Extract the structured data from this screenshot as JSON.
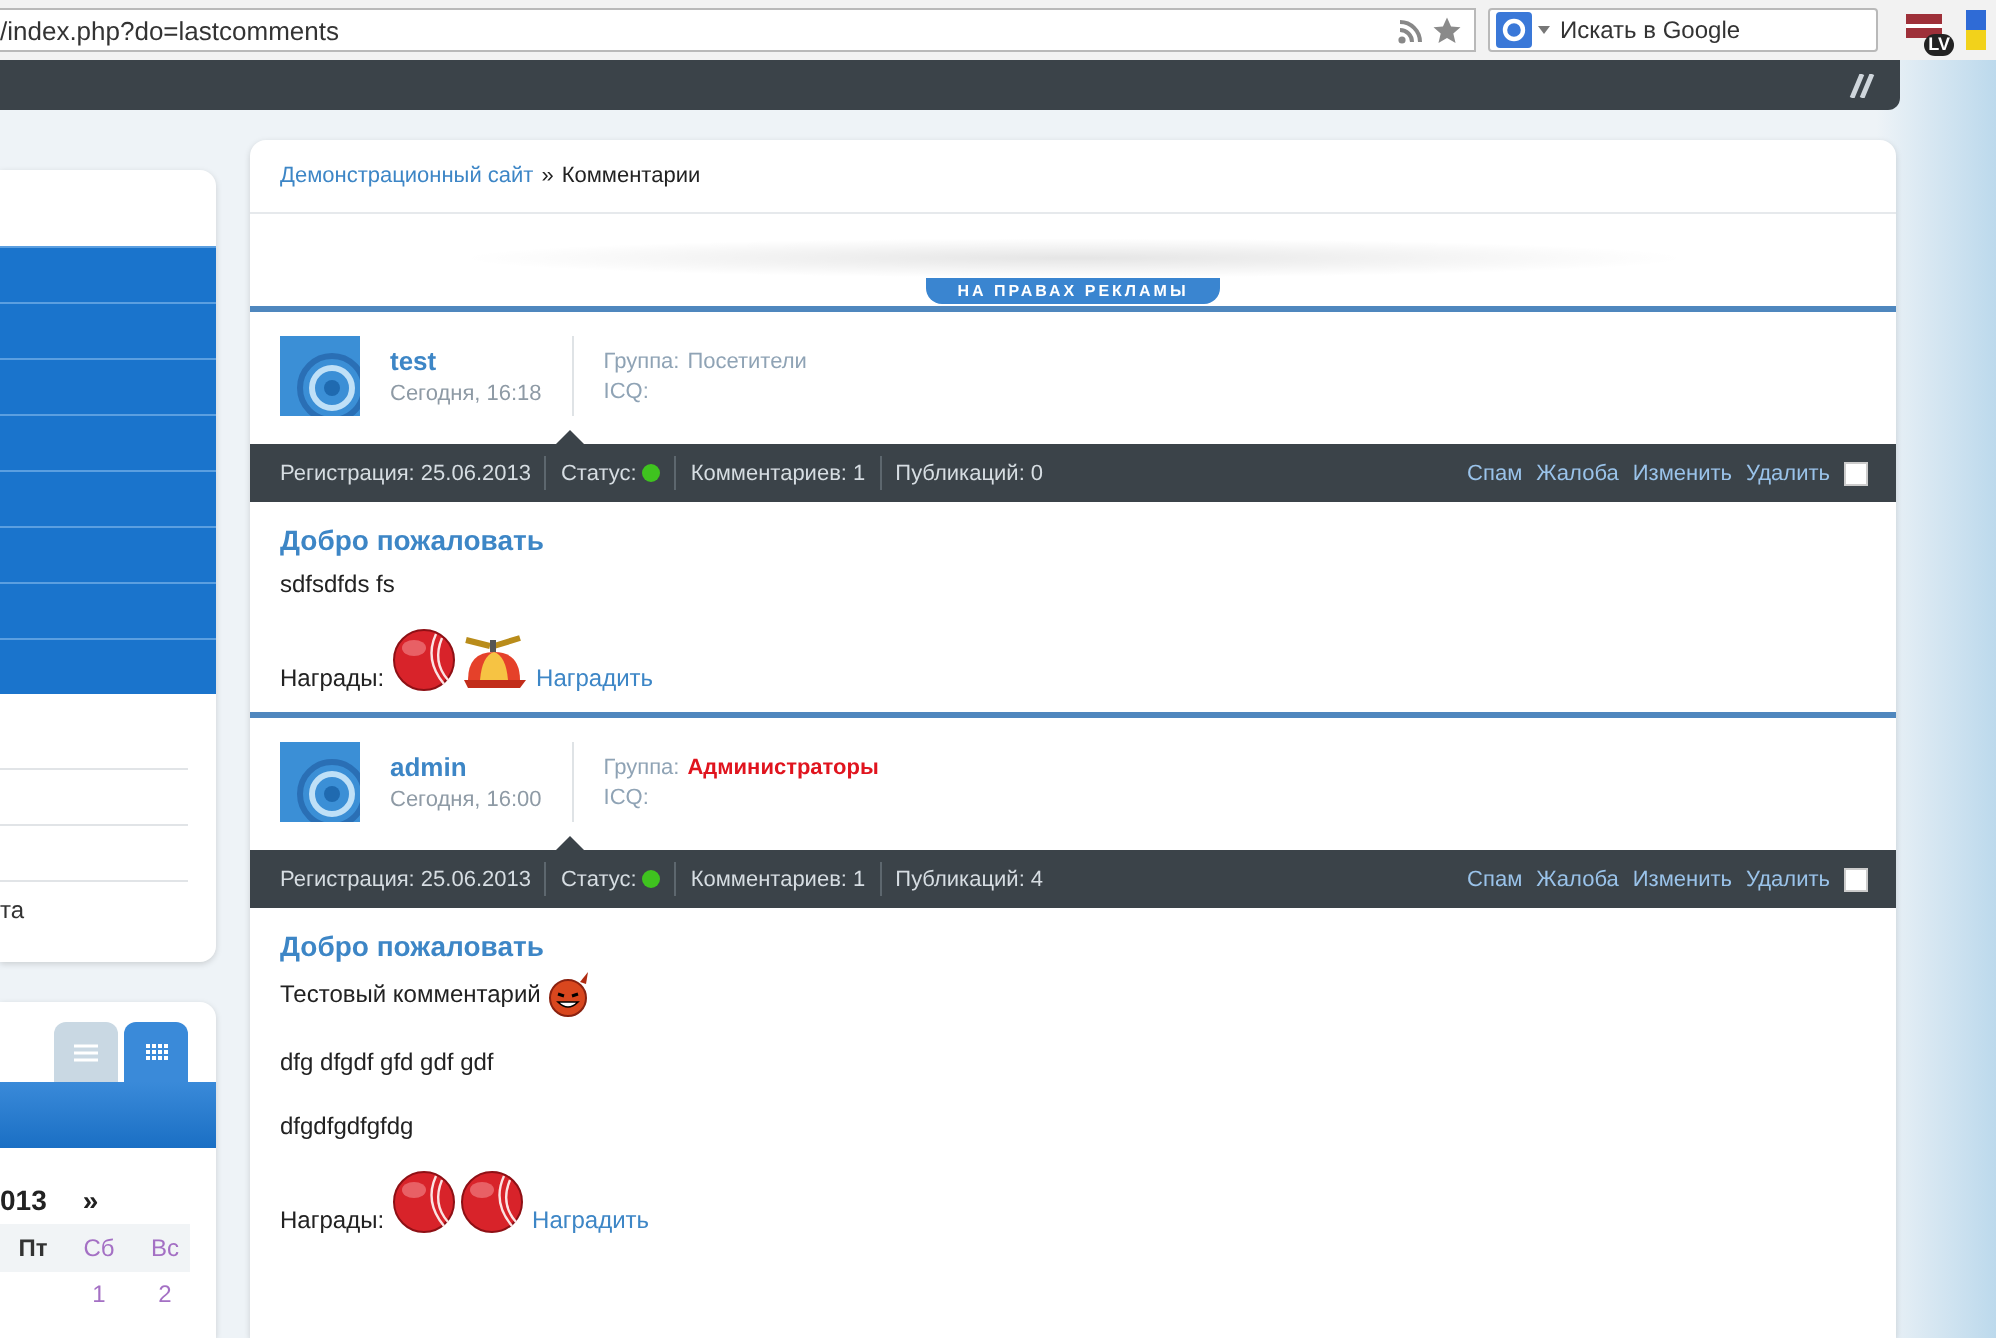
{
  "browser": {
    "url": "/index.php?do=lastcomments",
    "search": {
      "placeholder": "Искать в Google"
    },
    "extensions": [
      {
        "label": "LV"
      }
    ]
  },
  "sidebar": {
    "items": [
      {
        "label": "та"
      }
    ],
    "calendar": {
      "view_tabs": [
        {
          "kind": "list",
          "selected": false
        },
        {
          "kind": "grid",
          "selected": true
        }
      ],
      "year": "013",
      "next": "»",
      "days": [
        {
          "label": "Пт",
          "weekend": false
        },
        {
          "label": "Сб",
          "weekend": true,
          "date": "1"
        },
        {
          "label": "Вс",
          "weekend": true,
          "date": "2"
        }
      ]
    }
  },
  "breadcrumb": {
    "link": "Демонстрационный сайт",
    "separator": "»",
    "current": "Комментарии"
  },
  "ad_badge": "НА ПРАВАХ РЕКЛАМЫ",
  "comments": [
    {
      "author": "test",
      "time": "Сегодня, 16:18",
      "group_label": "Группа:",
      "group": "Посетители",
      "group_highlight": false,
      "icq": "ICQ:",
      "registration": "Регистрация: 25.06.2013",
      "status_label": "Статус:",
      "online": true,
      "comments_count": "Комментариев: 1",
      "publications": "Публикаций: 0",
      "actions": [
        "Спам",
        "Жалоба",
        "Изменить",
        "Удалить"
      ],
      "checked": false,
      "title": "Добро пожаловать",
      "lines": [
        {
          "text": "sdfsdfds fs",
          "smiley": false
        }
      ],
      "awards_label": "Награды:",
      "awards": [
        {
          "kind": "ball"
        },
        {
          "kind": "cap"
        }
      ],
      "award_link": "Наградить"
    },
    {
      "author": "admin",
      "time": "Сегодня, 16:00",
      "group_label": "Группа:",
      "group": "Администраторы",
      "group_highlight": true,
      "icq": "ICQ:",
      "registration": "Регистрация: 25.06.2013",
      "status_label": "Статус:",
      "online": true,
      "comments_count": "Комментариев: 1",
      "publications": "Публикаций: 4",
      "actions": [
        "Спам",
        "Жалоба",
        "Изменить",
        "Удалить"
      ],
      "checked": false,
      "title": "Добро пожаловать",
      "lines": [
        {
          "text": "Тестовый комментарий",
          "smiley": true
        },
        {
          "text": "dfg dfgdf gfd gdf gdf",
          "smiley": false
        },
        {
          "text": "dfgdfgdfgfdg",
          "smiley": false
        }
      ],
      "awards_label": "Награды:",
      "awards": [
        {
          "kind": "ball"
        },
        {
          "kind": "ball"
        }
      ],
      "award_link": "Наградить"
    }
  ]
}
